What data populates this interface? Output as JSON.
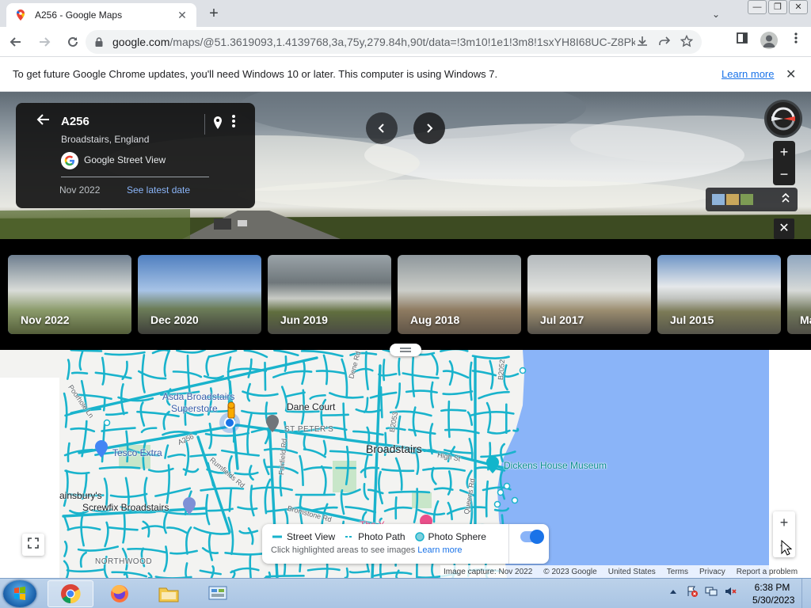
{
  "browser": {
    "tab_title": "A256 - Google Maps",
    "tab_close": "✕",
    "new_tab": "+",
    "tab_search": "⌄",
    "window_buttons": [
      "—",
      "❐",
      "✕"
    ],
    "url_host": "google.com",
    "url_rest": "/maps/@51.3619093,1.4139768,3a,75y,279.84h,90t/data=!3m10!1e1!3m8!1sxYH8I68UC-Z8PkdY..."
  },
  "infobar": {
    "message": "To get future Google Chrome updates, you'll need Windows 10 or later. This computer is using Windows 7.",
    "learn_more": "Learn more",
    "close": "✕"
  },
  "streetview": {
    "title": "A256",
    "subtitle": "Broadstairs, England",
    "provider": "Google Street View",
    "date": "Nov 2022",
    "see_latest": "See latest date",
    "close": "✕"
  },
  "timeline": [
    {
      "label": "Nov 2022",
      "selected": true
    },
    {
      "label": "Dec 2020",
      "selected": false
    },
    {
      "label": "Jun 2019",
      "selected": false
    },
    {
      "label": "Aug 2018",
      "selected": false
    },
    {
      "label": "Jul 2017",
      "selected": false
    },
    {
      "label": "Jul 2015",
      "selected": false
    },
    {
      "label": "Ma",
      "selected": false
    }
  ],
  "map": {
    "labels": {
      "asda": "Asda Broadstairs",
      "superstore": "Superstore",
      "dane_court": "Dane Court",
      "st_peters": "ST PETER'S",
      "broadstairs": "Broadstairs",
      "tesco": "Tesco Extra",
      "sainsburys": "ainsbury's",
      "screwfix": "Screwfix Broadstairs",
      "dickens": "Dickens House Museum",
      "northwood": "NORTHWOOD",
      "the_y": "The Y",
      "a256": "A256",
      "high_st": "High St",
      "queens_rd": "Queens Rd",
      "fairfield_rd": "Fairfield Rd",
      "rumfields_rd": "Rumfields Rd",
      "bromstone_rd": "Bromstone Rd",
      "poorhole_ln": "Poorhole Ln",
      "b2052": "B2052",
      "b2053": "B2053",
      "dene_rd": "Dene Rd"
    },
    "legend": {
      "street_view": "Street View",
      "photo_path": "Photo Path",
      "photo_sphere": "Photo Sphere",
      "hint": "Click highlighted areas to see images",
      "learn_more": "Learn more",
      "toggle_on": true
    },
    "zoom_in": "+",
    "zoom_out": "−",
    "footer": [
      "Image capture: Nov 2022",
      "© 2023 Google",
      "United States",
      "Terms",
      "Privacy",
      "Report a problem"
    ]
  },
  "taskbar": {
    "time": "6:38 PM",
    "date": "5/30/2023"
  },
  "colors": {
    "coverage": "#19b3cc",
    "sea": "#8ab4f8",
    "link": "#1a73e8"
  }
}
